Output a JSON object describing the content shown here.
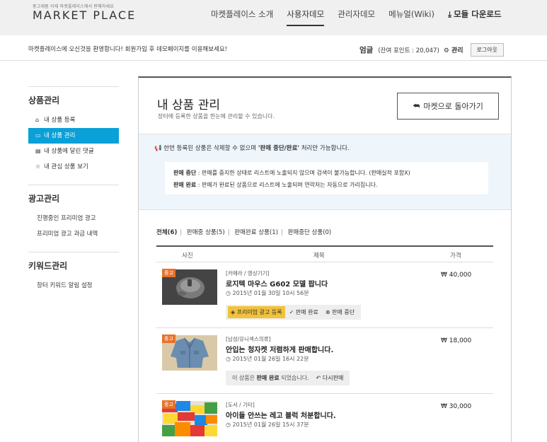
{
  "header": {
    "logo_sub": "중고제품 이제 마켓플레이스에서 판매하세요",
    "logo": "MARKET PLACE",
    "nav": [
      "마켓플레이스 소개",
      "사용자데모",
      "관리자데모",
      "메뉴얼(Wiki)"
    ],
    "download": "모듈 다운로드",
    "download_icon": "download-icon"
  },
  "welcome": {
    "text": "마켓플레이스에 오신것을 환영합니다! 회원가입 후 데모페이지를 이용해보세요!",
    "user": "엄글",
    "points": "(잔여 포인트 : 20,047)",
    "admin": "관리",
    "logout": "로그아웃"
  },
  "sidebar": {
    "sections": [
      {
        "title": "상품관리",
        "items": [
          {
            "icon": "home-icon",
            "glyph": "⌂",
            "label": "내 상품 등록"
          },
          {
            "icon": "box-icon",
            "glyph": "▭",
            "label": "내 상품 관리",
            "active": true
          },
          {
            "icon": "comment-icon",
            "glyph": "▤",
            "label": "내 상품에 달린 댓글"
          },
          {
            "icon": "star-icon",
            "glyph": "☆",
            "label": "내 관심 상품 보기"
          }
        ]
      },
      {
        "title": "광고관리",
        "items": [
          {
            "label": "진행중인 프리미엄 광고"
          },
          {
            "label": "프리미엄 광고 과금 내역"
          }
        ]
      },
      {
        "title": "키워드관리",
        "items": [
          {
            "label": "장터 키워드 알림 설정"
          }
        ]
      }
    ]
  },
  "main": {
    "title": "내 상품 관리",
    "subtitle": "장터에 등록한 상품을 한눈에 관리할 수 있습니다.",
    "back_label": "마켓으로 돌아가기",
    "notice_pre": "한번 등록된 상품은 삭제할 수 없으며 ",
    "notice_bold": "'판매 중단/완료'",
    "notice_post": " 처리만 가능합니다.",
    "notice_l1_bold": "판매 중단",
    "notice_l1": " : 판매를 중지한 상태로 리스트에 노출되지 않으며 검색이 불가능합니다. (판매실적 포함X)",
    "notice_l2_bold": "판매 완료",
    "notice_l2": " : 판매가 완료된 상품으로 리스트에 노출되며 연락처는 자동으로 가리집니다.",
    "filters": [
      "전체(6)",
      "판매중 상품(5)",
      "판매완료 상품(1)",
      "판매중단 상품(0)"
    ],
    "columns": {
      "photo": "사진",
      "title": "제목",
      "price": "가격"
    },
    "products": [
      {
        "tag": "중고",
        "category": "[카메라 / 영상기기]",
        "title": "로지텍 마우스 G602 모델 팝니다",
        "date": "2015년 01월 30일 10시 56분",
        "price": "₩ 40,000",
        "actions": [
          "프리미엄 광고 등록",
          "판매 완료",
          "판매 중단"
        ]
      },
      {
        "tag": "중고",
        "category": "[남성/유니섹스의류]",
        "title": "안입는 청자켓 저렴하게 판매합니다.",
        "date": "2015년 01월 26일 16시 22분",
        "price": "₩ 18,000",
        "sold_pre": "이 상품은 ",
        "sold_bold": "판매 완료",
        "sold_post": " 되었습니다.",
        "resell": "다시판매"
      },
      {
        "tag": "중고",
        "category": "[도서 / 기타]",
        "title": "아이들 안쓰는 레고 블럭 처분합니다.",
        "date": "2015년 01월 26일 15시 37분",
        "price": "₩ 30,000"
      }
    ]
  }
}
